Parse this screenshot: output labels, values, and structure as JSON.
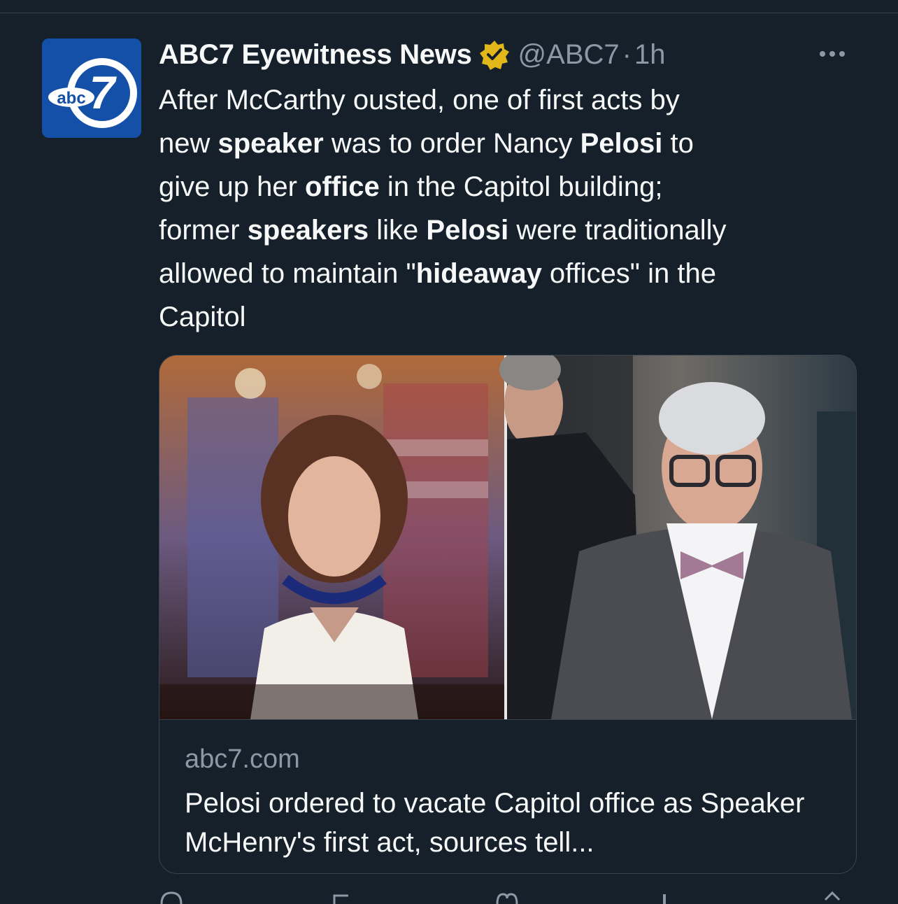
{
  "tweet": {
    "author_name": "ABC7 Eyewitness News",
    "handle": "@ABC7",
    "separator": "·",
    "time": "1h",
    "text_lines": [
      [
        {
          "t": "After McCarthy ousted, one of first acts by",
          "b": false
        }
      ],
      [
        {
          "t": "new ",
          "b": false
        },
        {
          "t": "speaker",
          "b": true
        },
        {
          "t": " was to order Nancy ",
          "b": false
        },
        {
          "t": "Pelosi",
          "b": true
        },
        {
          "t": " to",
          "b": false
        }
      ],
      [
        {
          "t": "give up her ",
          "b": false
        },
        {
          "t": "office",
          "b": true
        },
        {
          "t": " in the Capitol building;",
          "b": false
        }
      ],
      [
        {
          "t": "former ",
          "b": false
        },
        {
          "t": "speakers",
          "b": true
        },
        {
          "t": " like ",
          "b": false
        },
        {
          "t": "Pelosi",
          "b": true
        },
        {
          "t": " were traditionally",
          "b": false
        }
      ],
      [
        {
          "t": "allowed to maintain \"",
          "b": false
        },
        {
          "t": "hideaway",
          "b": true
        },
        {
          "t": " offices\" in the",
          "b": false
        }
      ],
      [
        {
          "t": "Capitol",
          "b": false
        }
      ]
    ]
  },
  "avatar": {
    "logo_text": "abc",
    "logo_number": "7"
  },
  "card": {
    "domain": "abc7.com",
    "title": "Pelosi ordered to vacate Capitol office as Speaker McHenry's first act, sources tell..."
  },
  "colors": {
    "background": "#15202b",
    "text_primary": "#f7f9f9",
    "text_secondary": "#8b98a5",
    "border": "#38444d",
    "verified_gold": "#e2b719",
    "avatar_blue": "#1450a8"
  },
  "icons": [
    "verified-badge-icon",
    "more-options-icon",
    "reply-icon",
    "retweet-icon",
    "like-icon",
    "views-icon",
    "share-icon"
  ]
}
